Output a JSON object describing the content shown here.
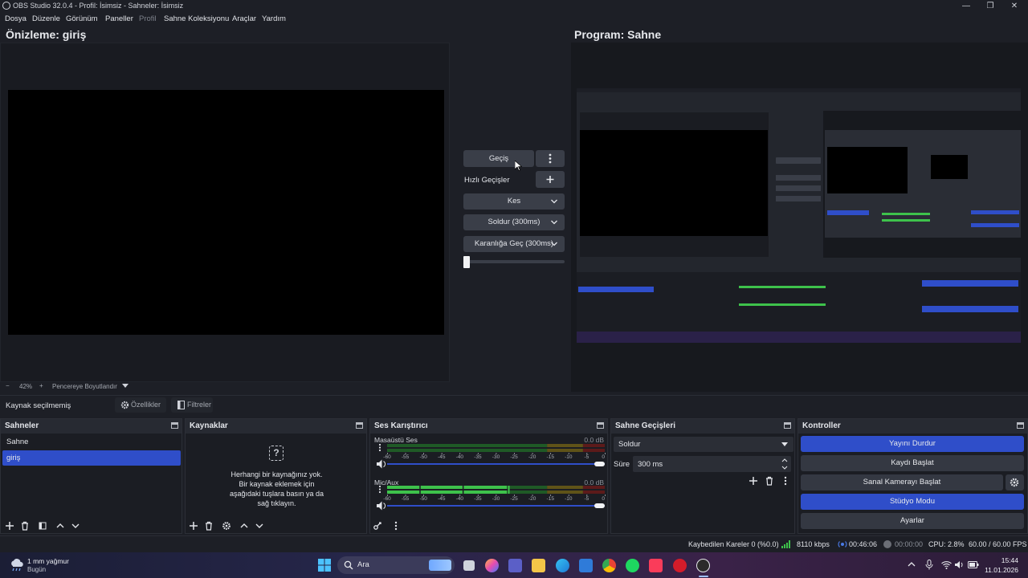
{
  "window": {
    "title": "OBS Studio 32.0.4 - Profil: İsimsiz - Sahneler: İsimsiz",
    "controls": [
      "—",
      "❐",
      "✕"
    ]
  },
  "menu": [
    "Dosya",
    "Düzenle",
    "Görünüm",
    "Paneller",
    "Profil",
    "Sahne Koleksiyonu",
    "Araçlar",
    "Yardım"
  ],
  "preview": {
    "title": "Önizleme: giriş",
    "zoom": "42%",
    "zoom_minus": "−",
    "zoom_plus": "+",
    "fit_label": "Pencereye Boyutlandır"
  },
  "program": {
    "title": "Program: Sahne"
  },
  "transitions_panel": {
    "transition_button": "Geçiş",
    "quick_label": "Hızlı Geçişler",
    "quick_items": [
      "Kes",
      "Soldur (300ms)",
      "Karanlığa Geç (300ms)"
    ],
    "tbar_progress": 0
  },
  "source_bar": {
    "status": "Kaynak seçilmemiş",
    "properties": "Özellikler",
    "filters": "Filtreler"
  },
  "scenes": {
    "title": "Sahneler",
    "items": [
      "Sahne",
      "giriş"
    ],
    "selected": "giriş"
  },
  "sources": {
    "title": "Kaynaklar",
    "empty_icon": "?",
    "empty_text": [
      "Herhangi bir kaynağınız yok.",
      "Bir kaynak eklemek için",
      "aşağıdaki tuşlara basın ya da",
      "sağ tıklayın."
    ]
  },
  "mixer": {
    "title": "Ses Karıştırıcı",
    "scale": [
      "-60",
      "-55",
      "-50",
      "-45",
      "-40",
      "-35",
      "-30",
      "-25",
      "-20",
      "-15",
      "-10",
      "-5",
      "0"
    ],
    "channels": [
      {
        "name": "Masaüstü Ses",
        "db": "0.0 dB",
        "level": 0,
        "volume": 1.0
      },
      {
        "name": "Mic/Aux",
        "db": "0.0 dB",
        "level": 0.55,
        "volume": 1.0
      }
    ]
  },
  "scene_transitions": {
    "title": "Sahne Geçişleri",
    "selected": "Soldur",
    "duration_label": "Süre",
    "duration_value": "300 ms"
  },
  "controls": {
    "title": "Kontroller",
    "buttons": [
      {
        "label": "Yayını Durdur",
        "active": true
      },
      {
        "label": "Kaydı Başlat",
        "active": false
      },
      {
        "label": "Sanal Kamerayı Başlat",
        "active": false
      },
      {
        "label": "Stüdyo Modu",
        "active": true
      },
      {
        "label": "Ayarlar",
        "active": false
      }
    ]
  },
  "status": {
    "dropped": "Kaybedilen Kareler 0 (%0.0)",
    "bitrate": "8110 kbps",
    "stream_time": "00:46:06",
    "rec_time": "00:00:00",
    "cpu": "CPU: 2.8%",
    "fps": "60.00 / 60.00 FPS"
  },
  "taskbar": {
    "weather_temp": "1 mm yağmur",
    "weather_sub": "Bugün",
    "search_placeholder": "Ara",
    "time": "15:44",
    "date": "11.01.2026"
  },
  "colors": {
    "accent": "#2f4ec9",
    "meter_green": "#3ec24b",
    "meter_yellow": "#b8a02a",
    "meter_red": "#b43030"
  }
}
